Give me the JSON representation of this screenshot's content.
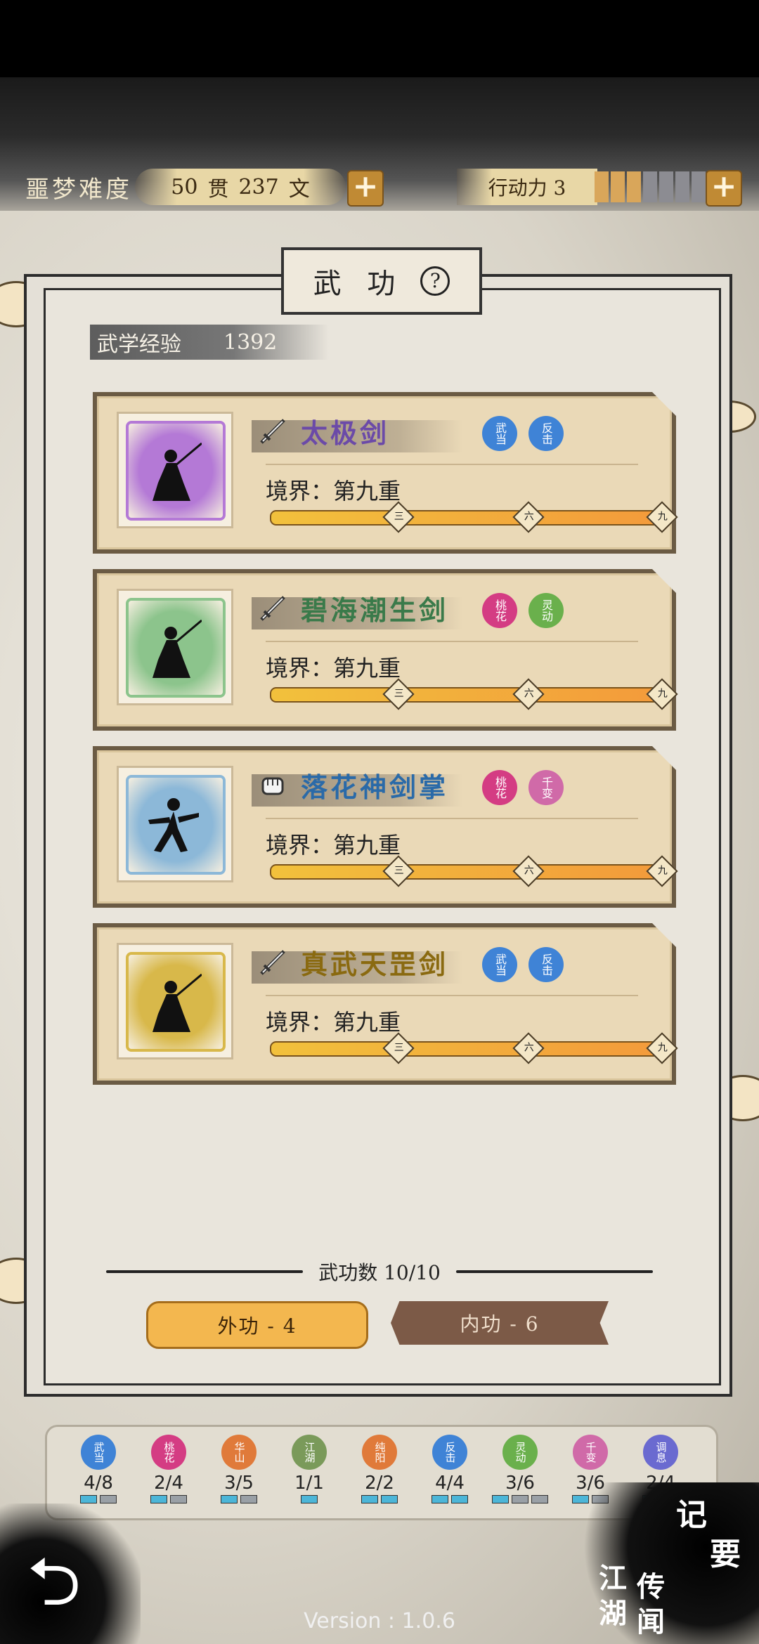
{
  "header": {
    "difficulty_label": "噩梦难度",
    "money": {
      "guan": "50",
      "guan_unit": "贯",
      "wen": "237",
      "wen_unit": "文"
    },
    "action_label": "行动力 3",
    "action_points": {
      "filled": 3,
      "total": 9
    }
  },
  "panel": {
    "title": "武 功",
    "help_icon": "?",
    "exp_label": "武学经验",
    "exp_value": "1392"
  },
  "skills": [
    {
      "name": "太极剑",
      "name_color": "#6b4aa8",
      "weapon": "sword-icon",
      "frame_color": "#b479d6",
      "tags": [
        {
          "text": "武当",
          "color": "#3f83d6"
        },
        {
          "text": "反击",
          "color": "#3f83d6"
        }
      ],
      "realm": "境界：第九重",
      "progress": 1.0
    },
    {
      "name": "碧海潮生剑",
      "name_color": "#3a7a4a",
      "weapon": "sword-icon",
      "frame_color": "#8cc48c",
      "tags": [
        {
          "text": "桃花",
          "color": "#d43c83"
        },
        {
          "text": "灵动",
          "color": "#6ab04c"
        }
      ],
      "realm": "境界：第九重",
      "progress": 1.0
    },
    {
      "name": "落花神剑掌",
      "name_color": "#2a6aa8",
      "weapon": "fist-icon",
      "frame_color": "#8cb8d8",
      "tags": [
        {
          "text": "桃花",
          "color": "#d43c83"
        },
        {
          "text": "千变",
          "color": "#d06aa8"
        }
      ],
      "realm": "境界：第九重",
      "progress": 1.0
    },
    {
      "name": "真武天罡剑",
      "name_color": "#8a6a10",
      "weapon": "sword-icon",
      "frame_color": "#d8b84a",
      "tags": [
        {
          "text": "武当",
          "color": "#3f83d6"
        },
        {
          "text": "反击",
          "color": "#3f83d6"
        }
      ],
      "realm": "境界：第九重",
      "progress": 1.0
    }
  ],
  "bar_marks": [
    "三",
    "六",
    "九"
  ],
  "skill_count": "武功数 10/10",
  "tabs": {
    "outer": "外功 - 4",
    "inner": "内功 - 6"
  },
  "sects": [
    {
      "name": "武当",
      "count": "4/8",
      "color": "#3f83d6",
      "pips": [
        1,
        0
      ]
    },
    {
      "name": "桃花",
      "count": "2/4",
      "color": "#d43c83",
      "pips": [
        1,
        0
      ]
    },
    {
      "name": "华山",
      "count": "3/5",
      "color": "#e07a3a",
      "pips": [
        1,
        0
      ]
    },
    {
      "name": "江湖",
      "count": "1/1",
      "color": "#7a9a5a",
      "pips": [
        1
      ]
    },
    {
      "name": "纯阳",
      "count": "2/2",
      "color": "#e07a3a",
      "pips": [
        1,
        1
      ]
    },
    {
      "name": "反击",
      "count": "4/4",
      "color": "#3f83d6",
      "pips": [
        1,
        1
      ]
    },
    {
      "name": "灵动",
      "count": "3/6",
      "color": "#6ab04c",
      "pips": [
        1,
        0,
        0
      ]
    },
    {
      "name": "千变",
      "count": "3/6",
      "color": "#d06aa8",
      "pips": [
        1,
        0
      ]
    },
    {
      "name": "调息",
      "count": "2/4",
      "color": "#6a6ad0",
      "pips": [
        1,
        0
      ]
    }
  ],
  "side_buttons": {
    "notes_1": "记",
    "notes_2": "要",
    "rumor_1": "江",
    "rumor_2": "湖",
    "rumor_3": "传",
    "rumor_4": "闻"
  },
  "back_icon": "back-arrow-icon",
  "version": "Version : 1.0.6"
}
